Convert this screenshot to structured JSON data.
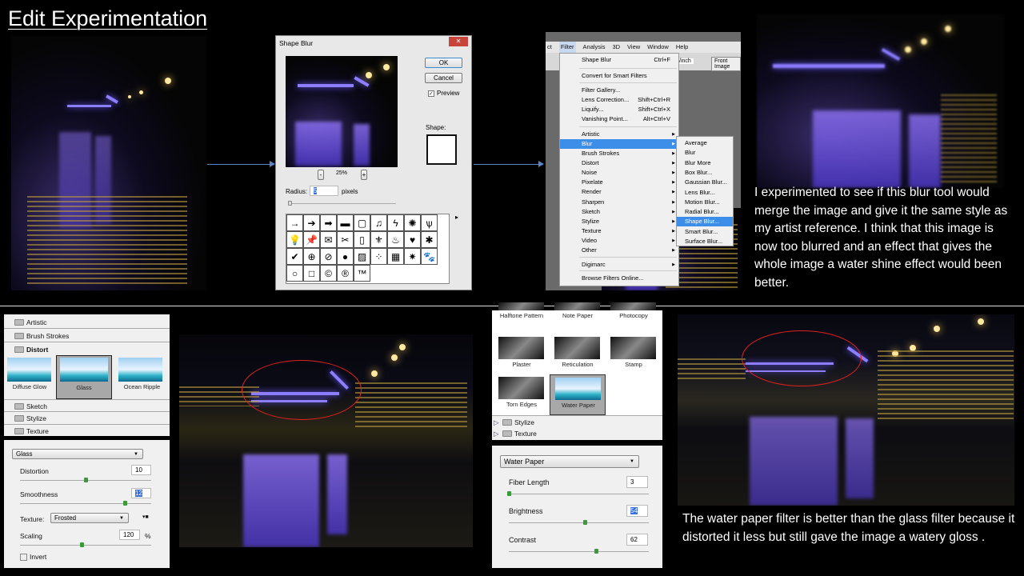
{
  "title": "Edit Experimentation",
  "shape_blur": {
    "title": "Shape Blur",
    "ok": "OK",
    "cancel": "Cancel",
    "preview": "Preview",
    "preview_checked": true,
    "shape_label": "Shape:",
    "zoom_out": "-",
    "zoom": "25%",
    "zoom_in": "+",
    "radius_label": "Radius:",
    "radius_value": "5",
    "radius_unit": "pixels",
    "shapes": [
      "→",
      "➔",
      "➡",
      "▬",
      "▢",
      "♫",
      "ϟ",
      "✺",
      "ѱ",
      "💡",
      "📌",
      "✉",
      "✂",
      "▯",
      "⚜",
      "♨",
      "♥",
      "✱",
      "✔",
      "⊕",
      "⊘",
      "●",
      "▨",
      "⁘",
      "▦",
      "✷",
      "🐾",
      "○",
      "□",
      "©",
      "®",
      "™"
    ]
  },
  "filter_menu": {
    "menubar": [
      "ct",
      "Filter",
      "Analysis",
      "3D",
      "View",
      "Window",
      "Help"
    ],
    "toolbar_right": [
      "/inch",
      "Front Image"
    ],
    "items": [
      {
        "label": "Shape Blur",
        "shortcut": "Ctrl+F"
      },
      {
        "label": "Convert for Smart Filters"
      },
      {
        "label": "Filter Gallery..."
      },
      {
        "label": "Lens Correction...",
        "shortcut": "Shift+Ctrl+R"
      },
      {
        "label": "Liquify...",
        "shortcut": "Shift+Ctrl+X"
      },
      {
        "label": "Vanishing Point...",
        "shortcut": "Alt+Ctrl+V"
      },
      {
        "label": "Artistic"
      },
      {
        "label": "Blur",
        "selected": true
      },
      {
        "label": "Brush Strokes"
      },
      {
        "label": "Distort"
      },
      {
        "label": "Noise"
      },
      {
        "label": "Pixelate"
      },
      {
        "label": "Render"
      },
      {
        "label": "Sharpen"
      },
      {
        "label": "Sketch"
      },
      {
        "label": "Stylize"
      },
      {
        "label": "Texture"
      },
      {
        "label": "Video"
      },
      {
        "label": "Other"
      },
      {
        "label": "Digimarc"
      },
      {
        "label": "Browse Filters Online..."
      }
    ],
    "blur_submenu": [
      "Average",
      "Blur",
      "Blur More",
      "Box Blur...",
      "Gaussian Blur...",
      "Lens Blur...",
      "Motion Blur...",
      "Radial Blur...",
      "Shape Blur...",
      "Smart Blur...",
      "Surface Blur..."
    ],
    "blur_selected": "Shape Blur..."
  },
  "text_top": "I experimented to see if this blur tool would merge the image and give it the same style as my artist reference. I think that this image is now too blurred and an effect that gives the whole image a water shine effect would been better.",
  "glass_gallery": {
    "folders_top": [
      "Artistic",
      "Brush Strokes"
    ],
    "open_folder": "Distort",
    "thumbs": [
      "Diffuse Glow",
      "Glass",
      "Ocean Ripple"
    ],
    "selected": "Glass",
    "folders_bottom": [
      "Sketch",
      "Stylize",
      "Texture"
    ]
  },
  "glass_settings": {
    "filter": "Glass",
    "distortion_label": "Distortion",
    "distortion": "10",
    "distortion_pct": 50,
    "smoothness_label": "Smoothness",
    "smoothness": "12",
    "smoothness_pct": 80,
    "texture_label": "Texture:",
    "texture": "Frosted",
    "scaling_label": "Scaling",
    "scaling": "120",
    "scaling_unit": "%",
    "scaling_pct": 47,
    "invert_label": "Invert",
    "invert": false
  },
  "water_gallery": {
    "thumbs": [
      "Halftone Pattern",
      "Note Paper",
      "Photocopy",
      "Plaster",
      "Reticulation",
      "Stamp",
      "Torn Edges",
      "Water Paper"
    ],
    "selected": "Water Paper",
    "folders": [
      "Stylize",
      "Texture"
    ]
  },
  "water_settings": {
    "filter": "Water Paper",
    "fiber_label": "Fiber Length",
    "fiber": "3",
    "fiber_pct": 0,
    "brightness_label": "Brightness",
    "brightness": "54",
    "brightness_pct": 54,
    "contrast_label": "Contrast",
    "contrast": "62",
    "contrast_pct": 62
  },
  "text_bottom": "The water paper filter is better than the glass filter because it distorted it less but still gave the image a watery gloss ."
}
